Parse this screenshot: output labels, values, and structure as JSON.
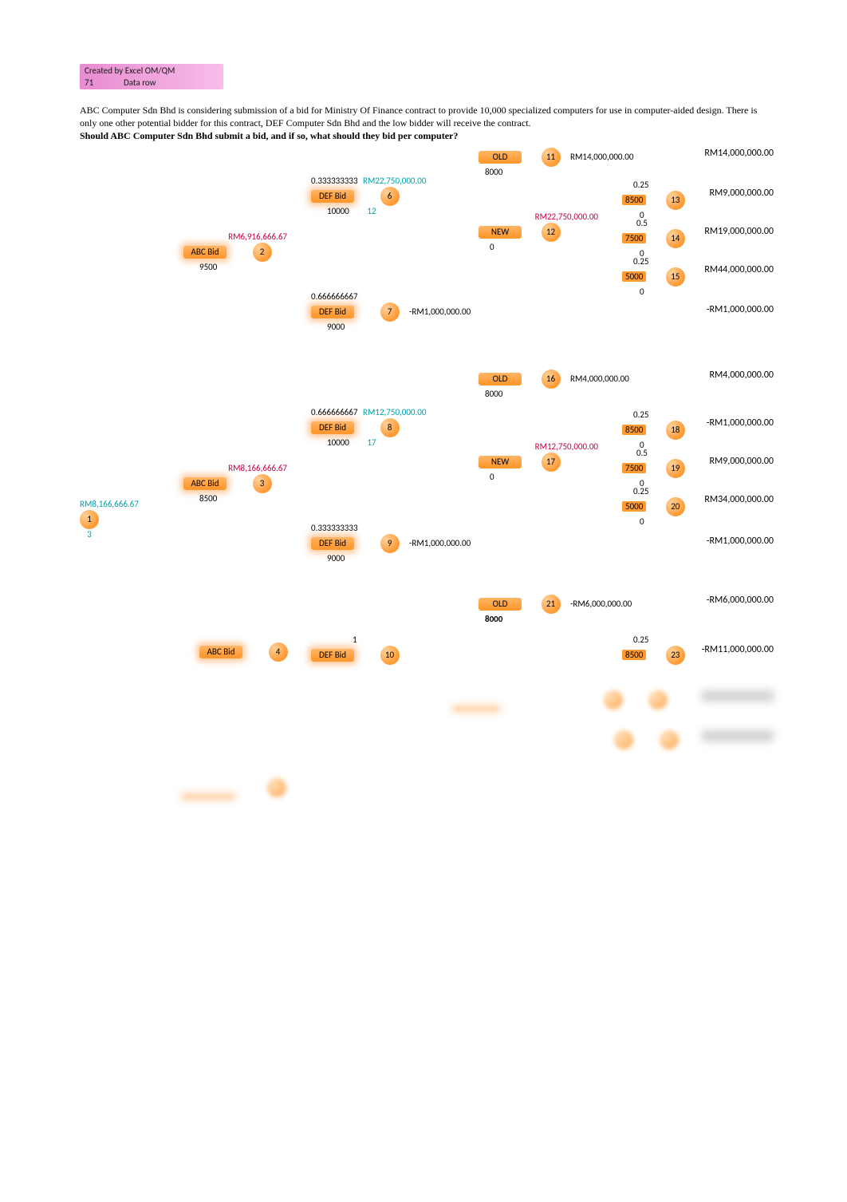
{
  "header": {
    "created": "Created by Excel OM/QM",
    "num": "71",
    "label": "Data row"
  },
  "paragraph": {
    "l1": "ABC Computer Sdn Bhd is considering submission of a bid for Ministry Of Finance contract to provide 10,000 specialized computers for use in computer-aided design. There is ",
    "l2": "only one other potential bidder for this contract, DEF Computer Sdn Bhd and the low bidder will receive the contract.",
    "q": "Should ABC Computer Sdn Bhd submit a bid, and if so, what should they bid per computer?"
  },
  "root": {
    "value": "RM8,166,666.67",
    "id": "1",
    "best": "3"
  },
  "abc": [
    {
      "price": "9500",
      "label": "ABC Bid",
      "id": "2",
      "value": "RM6,916,666.67"
    },
    {
      "price": "8500",
      "label": "ABC Bid",
      "id": "3",
      "value": "RM8,166,666.67"
    },
    {
      "price": "",
      "label": "ABC Bid",
      "id": "4",
      "value": ""
    }
  ],
  "def": [
    {
      "prob": "0.333333333",
      "branchval": "RM22,750,000.00",
      "label": "DEF Bid",
      "price": "10000",
      "id": "6",
      "best": "12"
    },
    {
      "prob": "0.666666667",
      "branchval": "",
      "label": "DEF Bid",
      "price": "9000",
      "id": "7",
      "result": "-RM1,000,000.00"
    },
    {
      "prob": "0.666666667",
      "branchval": "RM12,750,000.00",
      "label": "DEF Bid",
      "price": "10000",
      "id": "8",
      "best": "17"
    },
    {
      "prob": "0.333333333",
      "branchval": "",
      "label": "DEF Bid",
      "price": "9000",
      "id": "9",
      "result": "-RM1,000,000.00"
    },
    {
      "prob": "1",
      "branchval": "",
      "label": "DEF Bid",
      "price": "",
      "id": "10",
      "result": ""
    }
  ],
  "tech": [
    {
      "label": "OLD",
      "price": "8000",
      "id": "11",
      "value": "RM14,000,000.00"
    },
    {
      "branchval": "RM22,750,000.00",
      "label": "NEW",
      "price": "0",
      "id": "12"
    },
    {
      "label": "OLD",
      "price": "8000",
      "id": "16",
      "value": "RM4,000,000.00"
    },
    {
      "branchval": "RM12,750,000.00",
      "label": "NEW",
      "price": "0",
      "id": "17"
    },
    {
      "label": "OLD",
      "price": "8000",
      "id": "21",
      "value": "-RM6,000,000.00"
    }
  ],
  "leaves": [
    {
      "prob": "0.25",
      "price": "8500",
      "zero": "0",
      "id": "13",
      "payoff": "RM9,000,000.00"
    },
    {
      "prob": "0.5",
      "price": "7500",
      "zero": "0",
      "id": "14",
      "payoff": "RM19,000,000.00"
    },
    {
      "prob": "0.25",
      "price": "5000",
      "zero": "0",
      "id": "15",
      "payoff": "RM44,000,000.00"
    },
    {
      "prob": "0.25",
      "price": "8500",
      "zero": "0",
      "id": "18",
      "payoff": "-RM1,000,000.00"
    },
    {
      "prob": "0.5",
      "price": "7500",
      "zero": "0",
      "id": "19",
      "payoff": "RM9,000,000.00"
    },
    {
      "prob": "0.25",
      "price": "5000",
      "zero": "0",
      "id": "20",
      "payoff": "RM34,000,000.00"
    },
    {
      "prob": "0.25",
      "price": "8500",
      "zero": "",
      "id": "23",
      "payoff": "-RM11,000,000.00"
    }
  ],
  "rightcol": [
    "RM14,000,000.00",
    "RM9,000,000.00",
    "RM19,000,000.00",
    "RM44,000,000.00",
    "-RM1,000,000.00",
    "RM4,000,000.00",
    "-RM1,000,000.00",
    "RM9,000,000.00",
    "RM34,000,000.00",
    "-RM1,000,000.00",
    "-RM6,000,000.00",
    "-RM11,000,000.00"
  ]
}
